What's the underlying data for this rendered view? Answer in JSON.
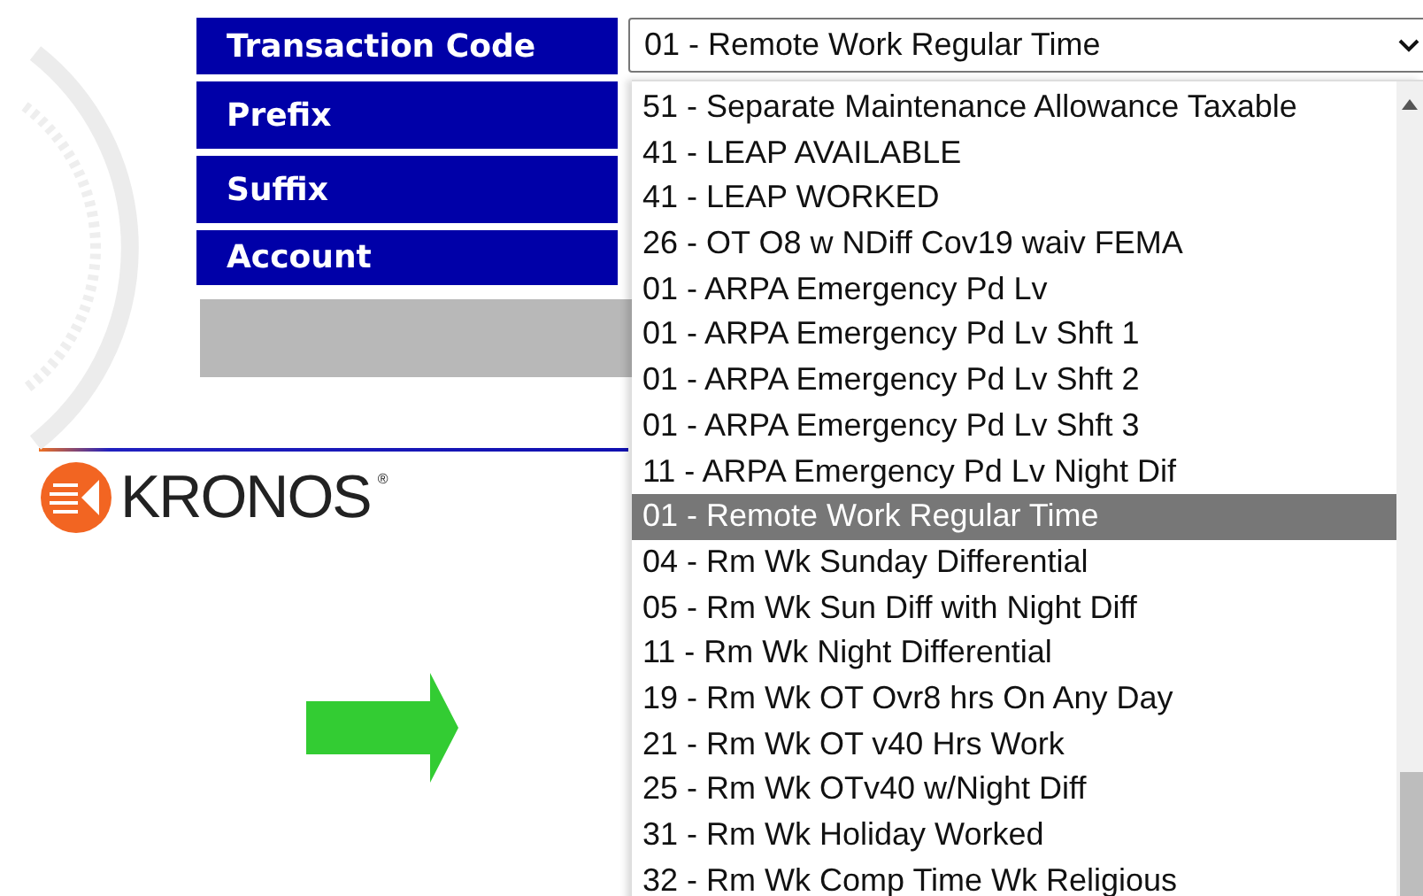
{
  "form": {
    "fields": [
      {
        "label": "Transaction Code"
      },
      {
        "label": "Prefix"
      },
      {
        "label": "Suffix"
      },
      {
        "label": "Account"
      }
    ]
  },
  "select": {
    "value": "01 - Remote Work Regular Time",
    "options": [
      {
        "label": "51 - Separate Maintenance Allowance Taxable",
        "selected": false
      },
      {
        "label": "41 - LEAP AVAILABLE",
        "selected": false
      },
      {
        "label": "41 - LEAP WORKED",
        "selected": false
      },
      {
        "label": "26 - OT O8 w NDiff Cov19 waiv FEMA",
        "selected": false
      },
      {
        "label": "01 - ARPA Emergency Pd Lv",
        "selected": false
      },
      {
        "label": "01 - ARPA Emergency Pd Lv Shft 1",
        "selected": false
      },
      {
        "label": "01 - ARPA Emergency Pd Lv Shft 2",
        "selected": false
      },
      {
        "label": "01 - ARPA Emergency Pd Lv Shft 3",
        "selected": false
      },
      {
        "label": "11 - ARPA Emergency Pd Lv Night Dif",
        "selected": false
      },
      {
        "label": "01 - Remote Work Regular Time",
        "selected": true
      },
      {
        "label": "04 - Rm Wk Sunday Differential",
        "selected": false
      },
      {
        "label": "05 - Rm Wk Sun Diff with Night Diff",
        "selected": false
      },
      {
        "label": "11 - Rm Wk Night Differential",
        "selected": false
      },
      {
        "label": "19 - Rm Wk OT Ovr8 hrs On Any Day",
        "selected": false
      },
      {
        "label": "21 - Rm Wk OT v40 Hrs Work",
        "selected": false
      },
      {
        "label": "25 - Rm Wk OTv40 w/Night Diff",
        "selected": false
      },
      {
        "label": "31 - Rm Wk Holiday Worked",
        "selected": false
      },
      {
        "label": "32 - Rm Wk Comp Time Wk Religious",
        "selected": false
      }
    ]
  },
  "logo": {
    "text": "KRONOS",
    "mark": "®"
  }
}
